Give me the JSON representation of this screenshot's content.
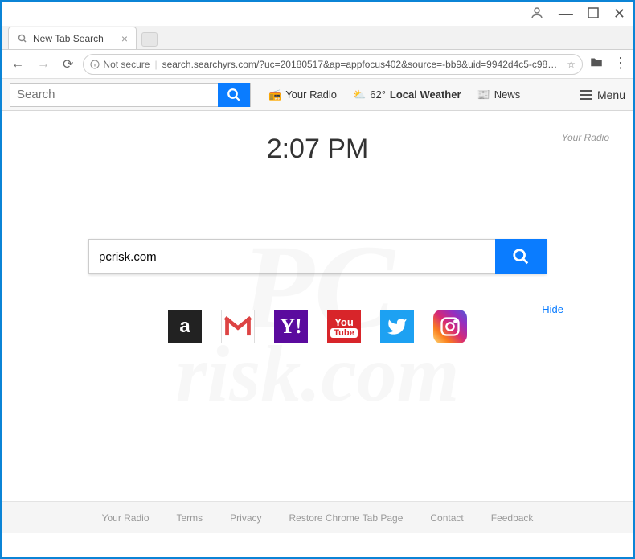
{
  "window": {
    "account_icon": "account",
    "min_icon": "minimize",
    "max_icon": "maximize",
    "close_icon": "close"
  },
  "tab": {
    "title": "New Tab Search",
    "close": "×"
  },
  "addr": {
    "back": "←",
    "fwd": "→",
    "reload": "⟳",
    "secure_label": "Not secure",
    "url": "search.searchyrs.com/?uc=20180517&ap=appfocus402&source=-bb9&uid=9942d4c5-c98b-4640-a...",
    "star": "☆"
  },
  "extbar": {
    "search_placeholder": "Search",
    "links": [
      {
        "icon": "📻",
        "label": "Your Radio"
      },
      {
        "icon": "⛅",
        "temp": "62°",
        "label": "Local Weather"
      },
      {
        "icon": "📰",
        "label": "News"
      }
    ],
    "menu_label": "Menu"
  },
  "page": {
    "clock": "2:07 PM",
    "brand": "Your Radio",
    "search_value": "pcrisk.com",
    "hide": "Hide",
    "tiles": [
      "amazon",
      "gmail",
      "yahoo",
      "youtube",
      "twitter",
      "instagram"
    ]
  },
  "footer": [
    "Your Radio",
    "Terms",
    "Privacy",
    "Restore Chrome Tab Page",
    "Contact",
    "Feedback"
  ],
  "watermark": {
    "top": "PC",
    "bottom": "risk.com"
  }
}
